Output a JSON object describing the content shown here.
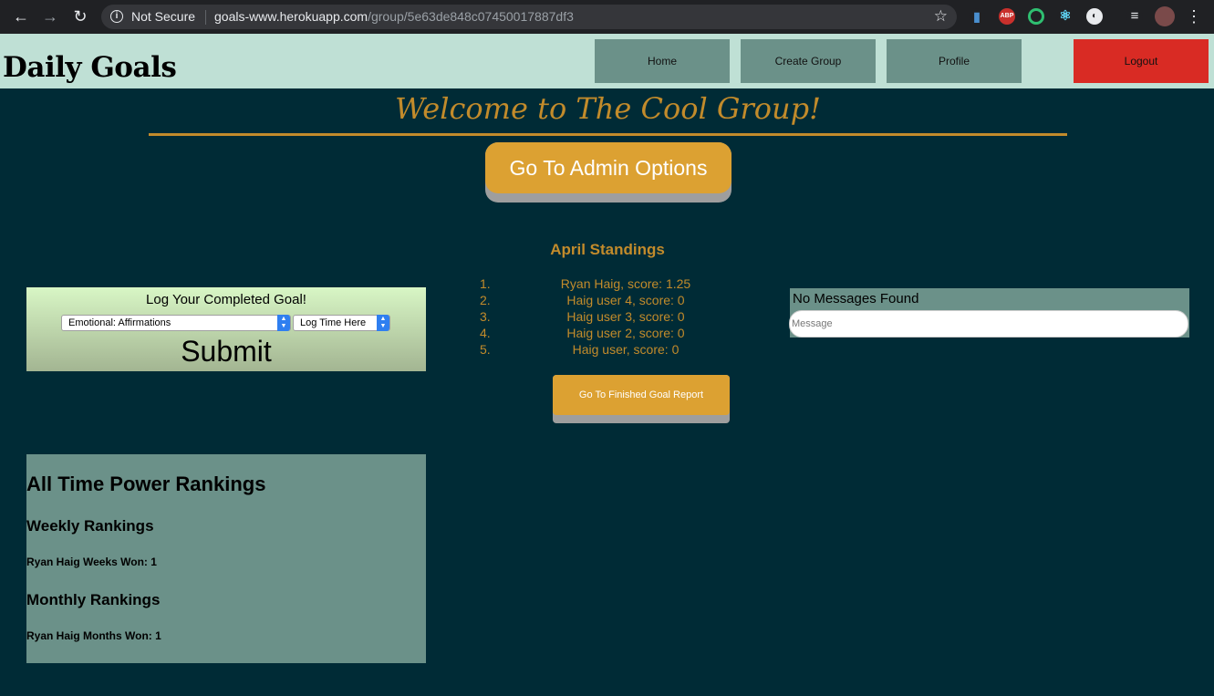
{
  "browser": {
    "not_secure": "Not Secure",
    "url_host": "goals-www.herokuapp.com",
    "url_path": "/group/5e63de848c07450017887df3"
  },
  "header": {
    "title": "Daily Goals",
    "nav": {
      "home": "Home",
      "create_group": "Create Group",
      "profile": "Profile",
      "logout": "Logout"
    }
  },
  "main": {
    "welcome": "Welcome to The Cool Group!",
    "admin_button": "Go To Admin Options"
  },
  "log_goal": {
    "title": "Log Your Completed Goal!",
    "goal_select": "Emotional: Affirmations",
    "time_select": "Log Time Here",
    "submit": "Submit"
  },
  "standings": {
    "title": "April Standings",
    "items": [
      {
        "num": "1.",
        "text": "Ryan Haig, score: 1.25"
      },
      {
        "num": "2.",
        "text": "Haig user 4, score: 0"
      },
      {
        "num": "3.",
        "text": "Haig user 3, score: 0"
      },
      {
        "num": "4.",
        "text": "Haig user 2, score: 0"
      },
      {
        "num": "5.",
        "text": "Haig user, score: 0"
      }
    ],
    "report_button": "Go To Finished Goal Report"
  },
  "messages": {
    "title": "No Messages Found",
    "placeholder": "Message"
  },
  "rankings": {
    "title": "All Time Power Rankings",
    "weekly_title": "Weekly Rankings",
    "weekly_entry": "Ryan Haig Weeks Won: 1",
    "monthly_title": "Monthly Rankings",
    "monthly_entry": "Ryan Haig Months Won: 1"
  },
  "colors": {
    "page_bg": "#002b36",
    "header_bg": "#bfe0d5",
    "nav_bg": "#6b9189",
    "logout_bg": "#d92b24",
    "accent_gold": "#c28b2b",
    "button_gold": "#dca132"
  }
}
